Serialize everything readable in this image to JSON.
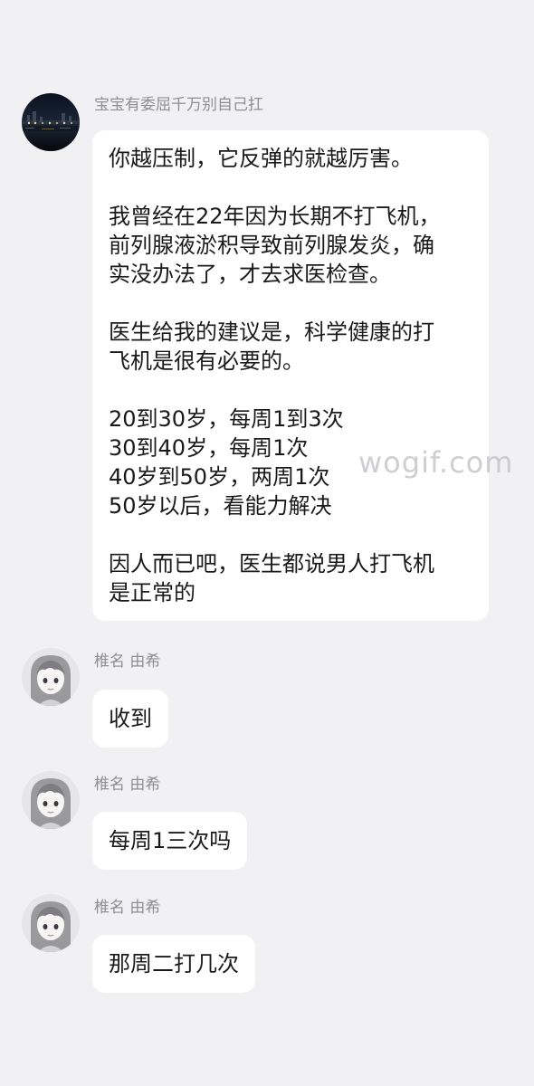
{
  "messages": [
    {
      "sender": "宝宝有委屈千万别自己扛",
      "avatar_icon": "night-city-avatar-icon",
      "paragraphs": [
        "你越压制，它反弹的就越厉害。",
        "我曾经在22年因为长期不打飞机，\n前列腺液淤积导致前列腺发炎，确\n实没办法了，才去求医检查。",
        "医生给我的建议是，科学健康的打\n飞机是很有必要的。",
        "20到30岁，每周1到3次\n30到40岁，每周1次\n40岁到50岁，两周1次\n50岁以后，看能力解决",
        "因人而已吧，医生都说男人打飞机\n是正常的"
      ]
    },
    {
      "sender": "椎名 由希",
      "avatar_icon": "anime-girl-avatar-icon",
      "text": "收到"
    },
    {
      "sender": "椎名 由希",
      "avatar_icon": "anime-girl-avatar-icon",
      "text": "每周1三次吗"
    },
    {
      "sender": "椎名 由希",
      "avatar_icon": "anime-girl-avatar-icon",
      "text": "那周二打几次"
    }
  ],
  "watermark": "wogif.com",
  "colors": {
    "background": "#f1f1f3",
    "bubble": "#ffffff",
    "text": "#1a1a1a",
    "sender": "#8e8e93"
  }
}
